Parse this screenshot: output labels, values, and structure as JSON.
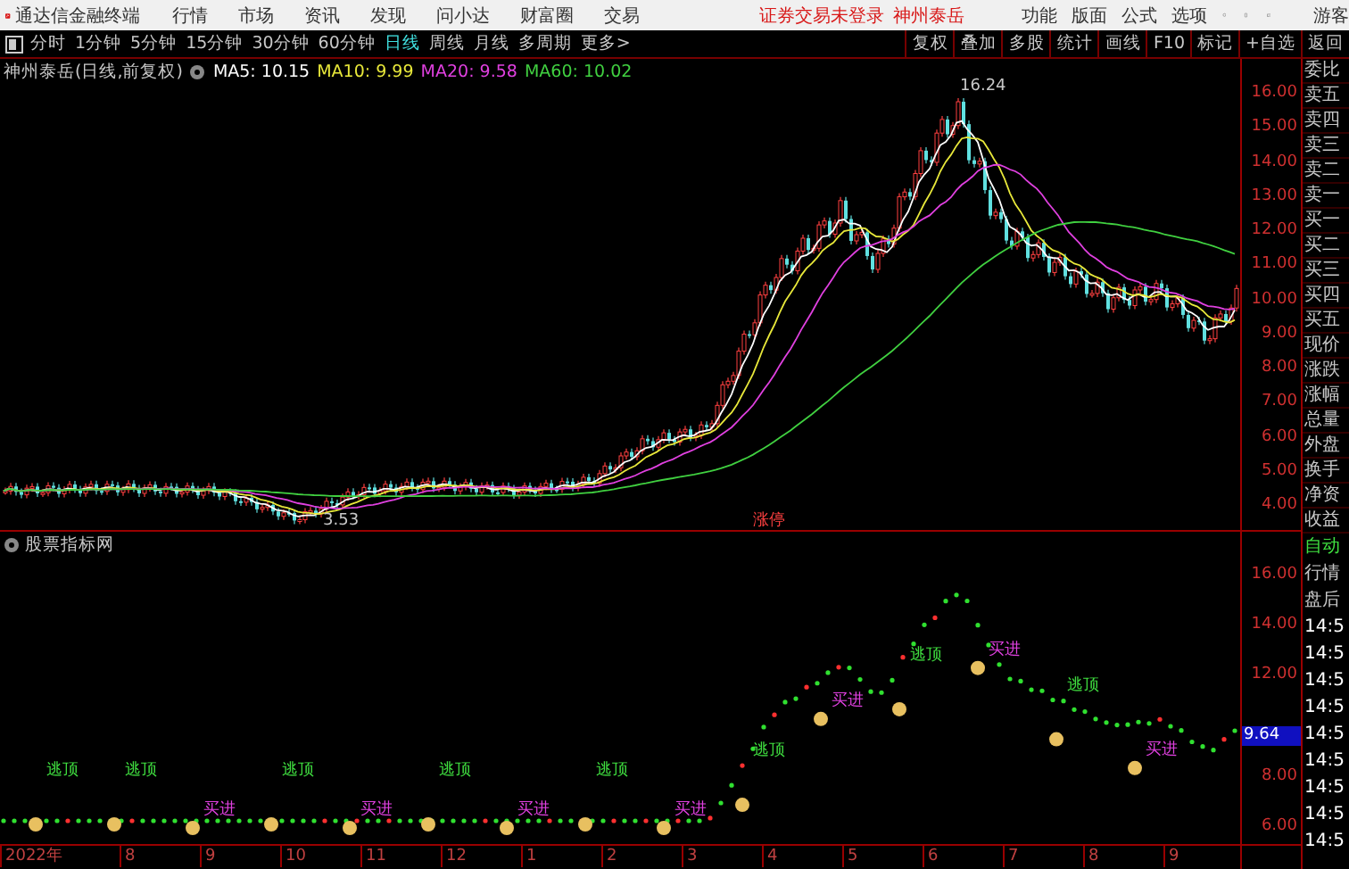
{
  "app": {
    "title": "通达信金融终端",
    "menus": [
      "行情",
      "市场",
      "资讯",
      "发现",
      "问小达",
      "财富圈",
      "交易"
    ],
    "login_status": "证券交易未登录",
    "stock": "神州泰岳",
    "right_menus": [
      "功能",
      "版面",
      "公式",
      "选项"
    ],
    "user": "游客"
  },
  "periods": [
    {
      "label": "分时",
      "selected": false
    },
    {
      "label": "1分钟",
      "selected": false
    },
    {
      "label": "5分钟",
      "selected": false
    },
    {
      "label": "15分钟",
      "selected": false
    },
    {
      "label": "30分钟",
      "selected": false
    },
    {
      "label": "60分钟",
      "selected": false
    },
    {
      "label": "日线",
      "selected": true
    },
    {
      "label": "周线",
      "selected": false
    },
    {
      "label": "月线",
      "selected": false
    },
    {
      "label": "多周期",
      "selected": false
    },
    {
      "label": "更多>",
      "selected": false
    }
  ],
  "tools": [
    "复权",
    "叠加",
    "多股",
    "统计",
    "画线",
    "F10",
    "标记",
    "+自选",
    "返回"
  ],
  "main_chart": {
    "legend_title": "神州泰岳(日线,前复权)",
    "ma": [
      {
        "label": "MA5: 10.15",
        "color": "#ffffff"
      },
      {
        "label": "MA10: 9.99",
        "color": "#e8e83a"
      },
      {
        "label": "MA20: 9.58",
        "color": "#e040e0"
      },
      {
        "label": "MA60: 10.02",
        "color": "#40d040"
      }
    ],
    "price_labels": [
      "16.00",
      "15.00",
      "14.00",
      "13.00",
      "12.00",
      "11.00",
      "10.00",
      "9.00",
      "8.00",
      "7.00",
      "6.00",
      "5.00",
      "4.00"
    ],
    "high_label": "16.24",
    "low_label": "3.53",
    "marker": "涨停"
  },
  "indicator": {
    "title": "股票指标网",
    "price_labels": [
      "16.00",
      "14.00",
      "12.00",
      "8.00",
      "6.00"
    ],
    "current": "9.64",
    "signals": [
      {
        "kind": "top",
        "label": "逃顶"
      },
      {
        "kind": "top",
        "label": "逃顶"
      },
      {
        "kind": "buy",
        "label": "买进"
      },
      {
        "kind": "top",
        "label": "逃顶"
      },
      {
        "kind": "buy",
        "label": "买进"
      },
      {
        "kind": "top",
        "label": "逃顶"
      },
      {
        "kind": "buy",
        "label": "买进"
      },
      {
        "kind": "top",
        "label": "逃顶"
      },
      {
        "kind": "buy",
        "label": "买进"
      },
      {
        "kind": "top",
        "label": "逃顶"
      },
      {
        "kind": "buy",
        "label": "买进"
      },
      {
        "kind": "top",
        "label": "逃顶"
      },
      {
        "kind": "buy",
        "label": "买进"
      },
      {
        "kind": "top",
        "label": "逃顶"
      },
      {
        "kind": "buy",
        "label": "买进"
      }
    ]
  },
  "x_axis": [
    "2022年",
    "8",
    "9",
    "10",
    "11",
    "12",
    "1",
    "2",
    "3",
    "4",
    "5",
    "6",
    "7",
    "8",
    "9"
  ],
  "side_panel": {
    "quote_labels": [
      "委比",
      "卖五",
      "卖四",
      "卖三",
      "卖二",
      "卖一",
      "买一",
      "买二",
      "买三",
      "买四",
      "买五",
      "现价",
      "涨跌",
      "涨幅",
      "总量",
      "外盘",
      "换手",
      "净资",
      "收益"
    ],
    "modes": [
      {
        "label": "自动",
        "selected": true
      },
      {
        "label": "行情",
        "selected": false
      },
      {
        "label": "盘后",
        "selected": false
      }
    ],
    "times": [
      "14:5",
      "14:5",
      "14:5",
      "14:5",
      "14:5",
      "14:5",
      "14:5",
      "14:5",
      "14:5"
    ]
  }
}
